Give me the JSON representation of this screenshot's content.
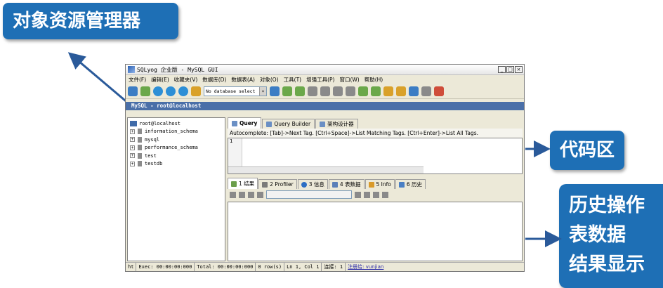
{
  "callouts": {
    "object_resources": "对象资源管理器",
    "code_area": "代码区",
    "bottom_lines": [
      "历史操作",
      "表数据",
      "结果显示"
    ]
  },
  "window": {
    "title": "SQLyog 企业版 - MySQL GUI",
    "controls": [
      "_",
      "□",
      "×"
    ],
    "menu": [
      "文件(F)",
      "编辑(E)",
      "收藏夹(V)",
      "数据库(D)",
      "数据表(A)",
      "对象(O)",
      "工具(T)",
      "增强工具(P)",
      "窗口(W)",
      "帮助(H)"
    ],
    "db_select": "No database select",
    "connection_title": "MySQL - root@localhost"
  },
  "tree": {
    "root": "root@localhost",
    "databases": [
      "information_schema",
      "mysql",
      "performance_schema",
      "test",
      "testdb"
    ]
  },
  "query": {
    "tabs": [
      "Query",
      "Query Builder",
      "架构设计器"
    ],
    "autocomplete": "Autocomplete: [Tab]->Next Tag. [Ctrl+Space]->List Matching Tags. [Ctrl+Enter]->List All Tags.",
    "line_number": "1"
  },
  "results": {
    "tabs": [
      "1 结果",
      "2 Profiler",
      "3 信息",
      "4 表数据",
      "5 Info",
      "6 历史"
    ]
  },
  "status": {
    "exec": "Exec: 00:00:00:000",
    "total": "Total: 00:00:00:000",
    "rows": "0 row(s)",
    "position": "Ln 1, Col 1",
    "connections": "连接: 1",
    "registered": "注册给: vunjian"
  },
  "colors": {
    "callout": "#1e6fb5",
    "connection_bar": "#4a6fa8",
    "window_bg": "#ece9d8"
  }
}
